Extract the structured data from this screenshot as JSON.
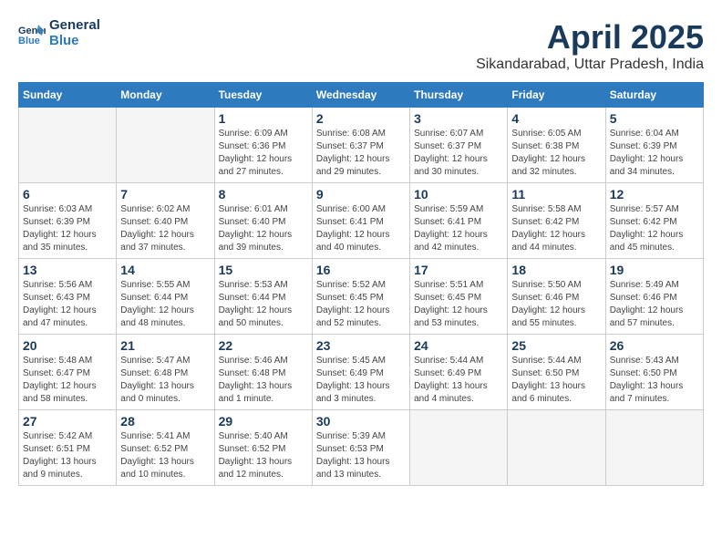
{
  "header": {
    "logo_line1": "General",
    "logo_line2": "Blue",
    "month": "April 2025",
    "location": "Sikandarabad, Uttar Pradesh, India"
  },
  "weekdays": [
    "Sunday",
    "Monday",
    "Tuesday",
    "Wednesday",
    "Thursday",
    "Friday",
    "Saturday"
  ],
  "weeks": [
    [
      {
        "day": "",
        "info": ""
      },
      {
        "day": "",
        "info": ""
      },
      {
        "day": "1",
        "info": "Sunrise: 6:09 AM\nSunset: 6:36 PM\nDaylight: 12 hours and 27 minutes."
      },
      {
        "day": "2",
        "info": "Sunrise: 6:08 AM\nSunset: 6:37 PM\nDaylight: 12 hours and 29 minutes."
      },
      {
        "day": "3",
        "info": "Sunrise: 6:07 AM\nSunset: 6:37 PM\nDaylight: 12 hours and 30 minutes."
      },
      {
        "day": "4",
        "info": "Sunrise: 6:05 AM\nSunset: 6:38 PM\nDaylight: 12 hours and 32 minutes."
      },
      {
        "day": "5",
        "info": "Sunrise: 6:04 AM\nSunset: 6:39 PM\nDaylight: 12 hours and 34 minutes."
      }
    ],
    [
      {
        "day": "6",
        "info": "Sunrise: 6:03 AM\nSunset: 6:39 PM\nDaylight: 12 hours and 35 minutes."
      },
      {
        "day": "7",
        "info": "Sunrise: 6:02 AM\nSunset: 6:40 PM\nDaylight: 12 hours and 37 minutes."
      },
      {
        "day": "8",
        "info": "Sunrise: 6:01 AM\nSunset: 6:40 PM\nDaylight: 12 hours and 39 minutes."
      },
      {
        "day": "9",
        "info": "Sunrise: 6:00 AM\nSunset: 6:41 PM\nDaylight: 12 hours and 40 minutes."
      },
      {
        "day": "10",
        "info": "Sunrise: 5:59 AM\nSunset: 6:41 PM\nDaylight: 12 hours and 42 minutes."
      },
      {
        "day": "11",
        "info": "Sunrise: 5:58 AM\nSunset: 6:42 PM\nDaylight: 12 hours and 44 minutes."
      },
      {
        "day": "12",
        "info": "Sunrise: 5:57 AM\nSunset: 6:42 PM\nDaylight: 12 hours and 45 minutes."
      }
    ],
    [
      {
        "day": "13",
        "info": "Sunrise: 5:56 AM\nSunset: 6:43 PM\nDaylight: 12 hours and 47 minutes."
      },
      {
        "day": "14",
        "info": "Sunrise: 5:55 AM\nSunset: 6:44 PM\nDaylight: 12 hours and 48 minutes."
      },
      {
        "day": "15",
        "info": "Sunrise: 5:53 AM\nSunset: 6:44 PM\nDaylight: 12 hours and 50 minutes."
      },
      {
        "day": "16",
        "info": "Sunrise: 5:52 AM\nSunset: 6:45 PM\nDaylight: 12 hours and 52 minutes."
      },
      {
        "day": "17",
        "info": "Sunrise: 5:51 AM\nSunset: 6:45 PM\nDaylight: 12 hours and 53 minutes."
      },
      {
        "day": "18",
        "info": "Sunrise: 5:50 AM\nSunset: 6:46 PM\nDaylight: 12 hours and 55 minutes."
      },
      {
        "day": "19",
        "info": "Sunrise: 5:49 AM\nSunset: 6:46 PM\nDaylight: 12 hours and 57 minutes."
      }
    ],
    [
      {
        "day": "20",
        "info": "Sunrise: 5:48 AM\nSunset: 6:47 PM\nDaylight: 12 hours and 58 minutes."
      },
      {
        "day": "21",
        "info": "Sunrise: 5:47 AM\nSunset: 6:48 PM\nDaylight: 13 hours and 0 minutes."
      },
      {
        "day": "22",
        "info": "Sunrise: 5:46 AM\nSunset: 6:48 PM\nDaylight: 13 hours and 1 minute."
      },
      {
        "day": "23",
        "info": "Sunrise: 5:45 AM\nSunset: 6:49 PM\nDaylight: 13 hours and 3 minutes."
      },
      {
        "day": "24",
        "info": "Sunrise: 5:44 AM\nSunset: 6:49 PM\nDaylight: 13 hours and 4 minutes."
      },
      {
        "day": "25",
        "info": "Sunrise: 5:44 AM\nSunset: 6:50 PM\nDaylight: 13 hours and 6 minutes."
      },
      {
        "day": "26",
        "info": "Sunrise: 5:43 AM\nSunset: 6:50 PM\nDaylight: 13 hours and 7 minutes."
      }
    ],
    [
      {
        "day": "27",
        "info": "Sunrise: 5:42 AM\nSunset: 6:51 PM\nDaylight: 13 hours and 9 minutes."
      },
      {
        "day": "28",
        "info": "Sunrise: 5:41 AM\nSunset: 6:52 PM\nDaylight: 13 hours and 10 minutes."
      },
      {
        "day": "29",
        "info": "Sunrise: 5:40 AM\nSunset: 6:52 PM\nDaylight: 13 hours and 12 minutes."
      },
      {
        "day": "30",
        "info": "Sunrise: 5:39 AM\nSunset: 6:53 PM\nDaylight: 13 hours and 13 minutes."
      },
      {
        "day": "",
        "info": ""
      },
      {
        "day": "",
        "info": ""
      },
      {
        "day": "",
        "info": ""
      }
    ]
  ]
}
